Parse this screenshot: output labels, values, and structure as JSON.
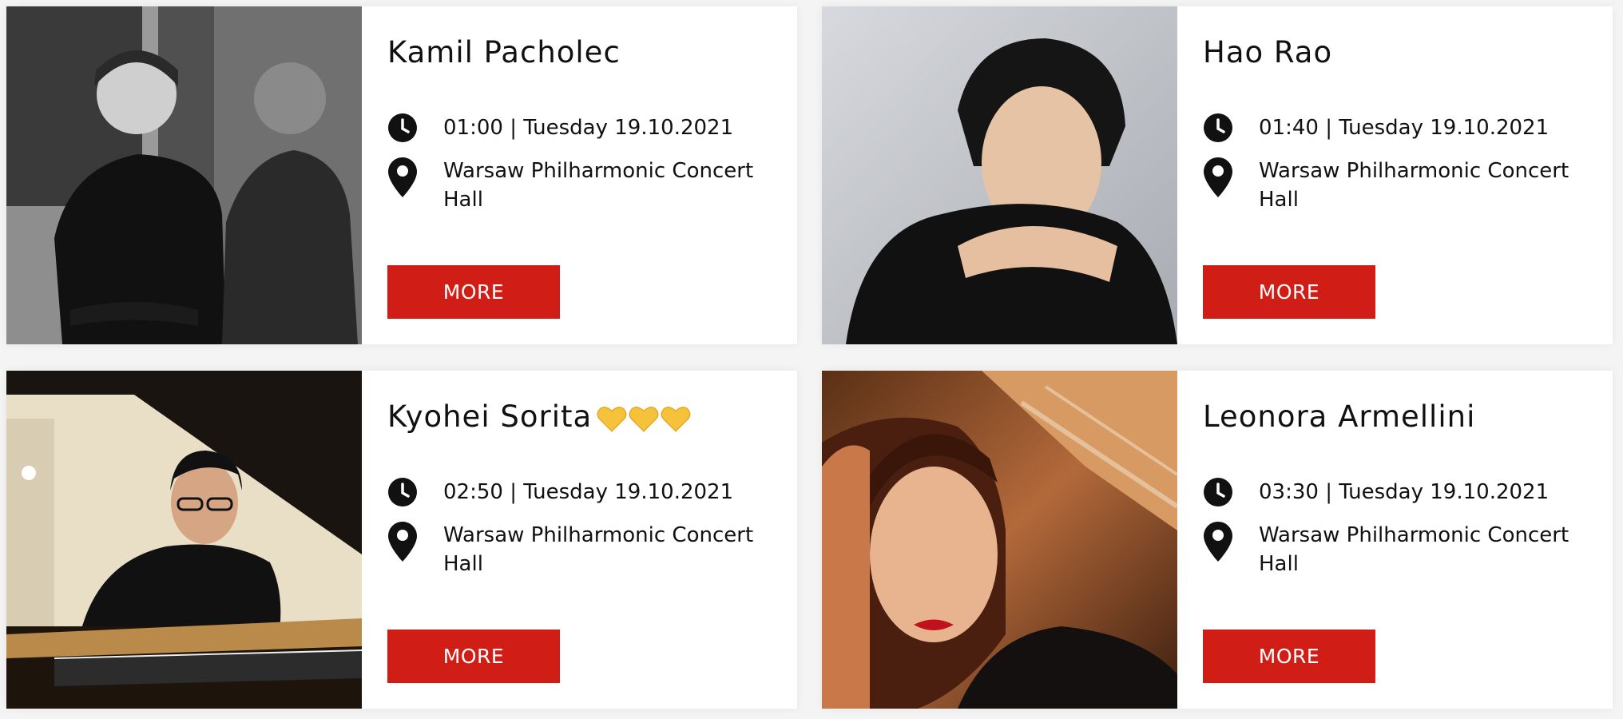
{
  "colors": {
    "accent": "#d01d16",
    "background": "#f4f4f4",
    "card": "#ffffff"
  },
  "cards": [
    {
      "name": "Kamil Pacholec",
      "time": "01:00 | Tuesday 19.10.2021",
      "venue": "Warsaw Philharmonic Concert Hall",
      "more": "MORE",
      "photo": "photo-of-pianist-black-and-white"
    },
    {
      "name": "Hao Rao",
      "time": "01:40 | Tuesday 19.10.2021",
      "venue": "Warsaw Philharmonic Concert Hall",
      "more": "MORE",
      "photo": "photo-of-pianist-hands-clasped"
    },
    {
      "name": "Kyohei Sorita",
      "emoji": "yellow-heart-icon x3",
      "time": "02:50 | Tuesday 19.10.2021",
      "venue": "Warsaw Philharmonic Concert Hall",
      "more": "MORE",
      "photo": "photo-of-pianist-at-piano"
    },
    {
      "name": "Leonora Armellini",
      "time": "03:30 | Tuesday 19.10.2021",
      "venue": "Warsaw Philharmonic Concert Hall",
      "more": "MORE",
      "photo": "photo-of-pianist-woman"
    }
  ]
}
